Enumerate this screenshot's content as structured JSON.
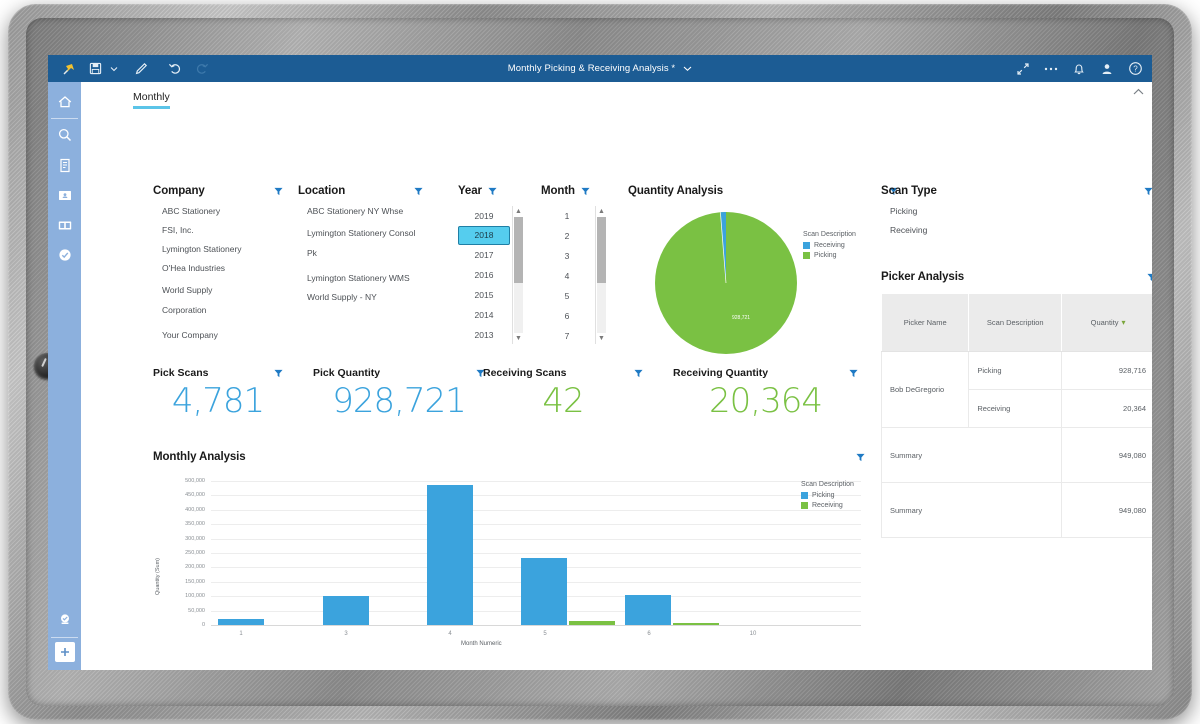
{
  "app": {
    "title": "Monthly Picking & Receiving Analysis *",
    "tab_label": "Monthly",
    "toolbar_icons": [
      "pin-icon",
      "save-icon",
      "save-dropdown-caret",
      "edit-pencil-icon",
      "undo-icon",
      "redo-icon"
    ],
    "right_icons": [
      "expand-icon",
      "more-options-icon",
      "notifications-bell-icon",
      "user-account-icon",
      "help-icon"
    ],
    "rail_icons": [
      "home-icon",
      "search-icon",
      "document-icon",
      "folder-icon",
      "cards-icon",
      "check-circle-icon",
      "badge-icon",
      "add-icon"
    ]
  },
  "colors": {
    "app_bar": "#1c5c94",
    "rail": "#8cb0dd",
    "accent_blue": "#3ba3dd",
    "accent_green": "#7ac143",
    "tab_underline": "#5bc4e8",
    "selected_row": "#55cdee",
    "summary_light": "#e6f3f0",
    "summary_dark": "#bfe3dd"
  },
  "filters": {
    "company": {
      "title": "Company",
      "items": [
        "ABC Stationery",
        "FSI, Inc.",
        "Lymington Stationery",
        "O'Hea Industries",
        "World Supply Corporation",
        "Your Company"
      ]
    },
    "location": {
      "title": "Location",
      "items": [
        "ABC Stationery NY Whse",
        "Lymington Stationery Consol Pk",
        "Lymington Stationery WMS",
        "World Supply - NY"
      ]
    },
    "year": {
      "title": "Year",
      "items": [
        "2019",
        "2018",
        "2017",
        "2016",
        "2015",
        "2014",
        "2013"
      ],
      "selected": "2018"
    },
    "month": {
      "title": "Month",
      "items": [
        "1",
        "2",
        "3",
        "4",
        "5",
        "6",
        "7"
      ],
      "selected": ""
    },
    "scan_type": {
      "title": "Scan Type",
      "items": [
        "Picking",
        "Receiving"
      ]
    }
  },
  "kpis": [
    {
      "label": "Pick Scans",
      "value": "4,781",
      "color": "#3ba3dd"
    },
    {
      "label": "Pick Quantity",
      "value": "928,721",
      "color": "#3ba3dd"
    },
    {
      "label": "Receiving Scans",
      "value": "42",
      "color": "#7ac143"
    },
    {
      "label": "Receiving Quantity",
      "value": "20,364",
      "color": "#7ac143"
    }
  ],
  "picker_analysis": {
    "title": "Picker Analysis",
    "columns": [
      "Picker Name",
      "Scan Description",
      "Quantity"
    ],
    "sort_column": "Quantity",
    "rows": [
      {
        "name": "Bob DeGregorio",
        "scan": "Picking",
        "qty": "928,716"
      },
      {
        "name": "",
        "scan": "Receiving",
        "qty": "20,364"
      }
    ],
    "summary_rows": [
      {
        "label": "Summary",
        "qty": "949,080"
      },
      {
        "label": "Summary",
        "qty": "949,080"
      }
    ]
  },
  "chart_data": [
    {
      "type": "pie",
      "title": "Quantity Analysis",
      "legend_title": "Scan Description",
      "legend_position": "right",
      "slices": [
        {
          "name": "Picking",
          "value": 928721,
          "label": "928,721",
          "color": "#7ac143"
        },
        {
          "name": "Receiving",
          "value": 20364,
          "label": "",
          "color": "#3ba3dd"
        }
      ]
    },
    {
      "type": "bar",
      "title": "Monthly Analysis",
      "xlabel": "Month Numeric",
      "ylabel": "Quantity (Sum)",
      "categories": [
        "1",
        "3",
        "4",
        "5",
        "6",
        "10"
      ],
      "ylim": [
        0,
        500000
      ],
      "yticks": [
        "0",
        "50,000",
        "100,000",
        "150,000",
        "200,000",
        "250,000",
        "300,000",
        "350,000",
        "400,000",
        "450,000",
        "500,000"
      ],
      "grid": true,
      "legend_title": "Scan Description",
      "legend_position": "right",
      "series": [
        {
          "name": "Picking",
          "color": "#3ba3dd",
          "values": [
            20000,
            100000,
            487000,
            232000,
            105000,
            0
          ]
        },
        {
          "name": "Receiving",
          "color": "#7ac143",
          "values": [
            0,
            0,
            0,
            15000,
            5000,
            0
          ]
        }
      ]
    }
  ]
}
